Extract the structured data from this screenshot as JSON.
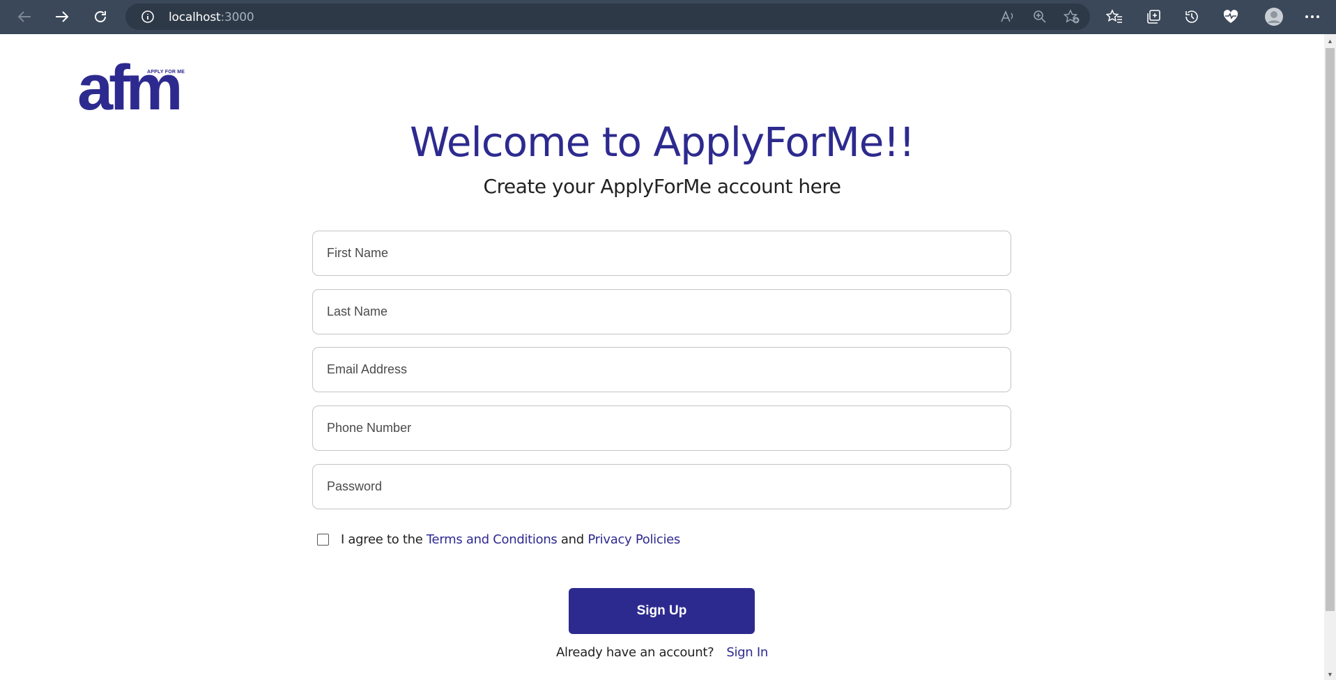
{
  "browser": {
    "url_host": "localhost",
    "url_port": ":3000",
    "icons": [
      "back-icon",
      "forward-icon",
      "refresh-icon",
      "info-icon",
      "read-aloud-icon",
      "zoom-icon",
      "add-favorite-icon",
      "favorites-icon",
      "collections-icon",
      "history-icon",
      "health-icon",
      "profile-icon",
      "more-icon"
    ]
  },
  "logo": {
    "text": "afm",
    "tagline": "APPLY FOR ME"
  },
  "header": {
    "title": "Welcome to ApplyForMe!!",
    "subtitle": "Create your ApplyForMe account here"
  },
  "form": {
    "first_name_placeholder": "First Name",
    "last_name_placeholder": "Last Name",
    "email_placeholder": "Email Address",
    "phone_placeholder": "Phone Number",
    "password_placeholder": "Password",
    "agree_prefix": "I agree to the ",
    "terms_link": "Terms and Conditions",
    "agree_and": " and ",
    "privacy_link": "Privacy Policies",
    "submit_label": "Sign Up"
  },
  "footer": {
    "prompt": "Already have an account?",
    "signin_link": "Sign In"
  },
  "colors": {
    "brand": "#2d2a8f",
    "chrome": "#3b4859"
  }
}
